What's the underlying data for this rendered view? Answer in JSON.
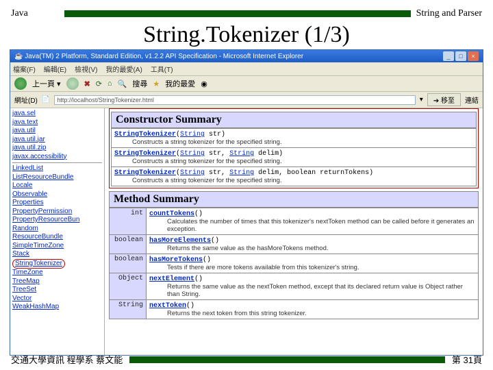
{
  "header": {
    "left": "Java",
    "right": "String and Parser"
  },
  "title": "String.Tokenizer (1/3)",
  "ie": {
    "windowTitle": "Java(TM) 2 Platform, Standard Edition, v1.2.2 API Specification - Microsoft Internet Explorer",
    "menu": [
      "檔案(F)",
      "編輯(E)",
      "檢視(V)",
      "我的最愛(A)",
      "工具(T)"
    ],
    "toolbar": {
      "back": "上一頁 ▾",
      "search": "搜尋",
      "fav": "我的最愛"
    },
    "addr": {
      "label": "網址(D)",
      "value": "http://localhost/StringTokenizer.html",
      "go": "移至",
      "links": "連結"
    }
  },
  "leftNav": {
    "pkgs": [
      "java.sel",
      "java.text",
      "java.util",
      "java.util.jar",
      "java.util.zip",
      "javax.accessibility"
    ],
    "classes": [
      "LinkedList",
      "ListResourceBundle",
      "Locale",
      "Observable",
      "Properties",
      "PropertyPermission",
      "PropertyResourceBun",
      "Random",
      "ResourceBundle",
      "SimpleTimeZone",
      "Stack",
      "StringTokenizer",
      "TimeZone",
      "TreeMap",
      "TreeSet",
      "Vector",
      "WeakHashMap"
    ]
  },
  "ctor": {
    "title": "Constructor Summary",
    "rows": [
      {
        "sig": [
          "StringTokenizer",
          "(",
          "String",
          " str)"
        ],
        "desc": "Constructs a string tokenizer for the specified string."
      },
      {
        "sig": [
          "StringTokenizer",
          "(",
          "String",
          " str, ",
          "String",
          " delim)"
        ],
        "desc": "Constructs a string tokenizer for the specified string."
      },
      {
        "sig": [
          "StringTokenizer",
          "(",
          "String",
          " str, ",
          "String",
          " delim, boolean returnTokens)"
        ],
        "desc": "Constructs a string tokenizer for the specified string."
      }
    ]
  },
  "meth": {
    "title": "Method Summary",
    "rows": [
      {
        "mod": "int",
        "name": "countTokens",
        "after": "()",
        "desc": "Calculates the number of times that this tokenizer's nextToken method can be called before it generates an exception."
      },
      {
        "mod": "boolean",
        "name": "hasMoreElements",
        "after": "()",
        "desc": "Returns the same value as the hasMoreTokens method."
      },
      {
        "mod": "boolean",
        "name": "hasMoreTokens",
        "after": "()",
        "desc": "Tests if there are more tokens available from this tokenizer's string."
      },
      {
        "mod": "Object",
        "name": "nextElement",
        "after": "()",
        "desc": "Returns the same value as the nextToken method, except that its declared return value is Object rather than String."
      },
      {
        "mod": "String",
        "name": "nextToken",
        "after": "()",
        "desc": "Returns the next token from this string tokenizer."
      }
    ]
  },
  "footer": {
    "left": "交通大學資訊 程學系 蔡文能",
    "right": "第 31頁"
  }
}
